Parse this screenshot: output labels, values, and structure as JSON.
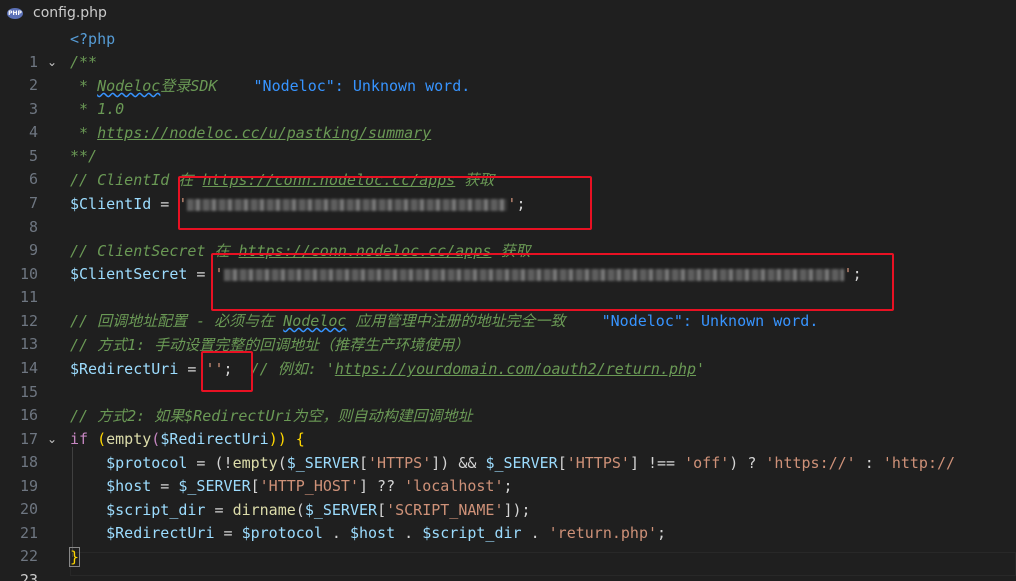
{
  "tab": {
    "badge": "PHP",
    "filename": "config.php"
  },
  "lines": [
    {
      "n": "1"
    },
    {
      "n": "2"
    },
    {
      "n": "3"
    },
    {
      "n": "4"
    },
    {
      "n": "5"
    },
    {
      "n": "6"
    },
    {
      "n": "7"
    },
    {
      "n": "8"
    },
    {
      "n": "9"
    },
    {
      "n": "10"
    },
    {
      "n": "11"
    },
    {
      "n": "12"
    },
    {
      "n": "13"
    },
    {
      "n": "14"
    },
    {
      "n": "15"
    },
    {
      "n": "16"
    },
    {
      "n": "17"
    },
    {
      "n": "18"
    },
    {
      "n": "19"
    },
    {
      "n": "20"
    },
    {
      "n": "21"
    },
    {
      "n": "22"
    },
    {
      "n": "23"
    }
  ],
  "code": {
    "l1": "<?php",
    "l2": "/**",
    "l3_star": " * ",
    "l3_word": "Nodeloc",
    "l3_rest": "登录SDK",
    "l3_diag": "\"Nodeloc\": Unknown word.",
    "l4": " * 1.0",
    "l5_star": " * ",
    "l5_url": "https://nodeloc.cc/u/pastking/summary",
    "l6": "**/",
    "l7_a": "// ClientId 在 ",
    "l7_url": "https://conn.nodeloc.cc/apps",
    "l7_b": " 获取",
    "l8_var": "$ClientId",
    "l8_eq": " = ",
    "l8_q1": "'",
    "l8_q2": "'",
    "l8_end": ";",
    "l10_a": "// ClientSecret 在 ",
    "l10_url": "https://conn.nodeloc.cc/apps",
    "l10_b": " 获取",
    "l11_var": "$ClientSecret",
    "l11_eq": " = ",
    "l11_q1": "'",
    "l11_q2": "'",
    "l11_end": ";",
    "l13_a": "// 回调地址配置 - 必须与在 ",
    "l13_word": "Nodeloc",
    "l13_b": " 应用管理中注册的地址完全一致",
    "l13_diag": "\"Nodeloc\": Unknown word.",
    "l14": "// 方式1: 手动设置完整的回调地址（推荐生产环境使用）",
    "l15_var": "$RedirectUri",
    "l15_eq": " = ",
    "l15_str": "''",
    "l15_semi": ";",
    "l15_c1": "  // 例如: '",
    "l15_url": "https://yourdomain.com/oauth2/return.php",
    "l15_c2": "'",
    "l17": "// 方式2: 如果$RedirectUri为空，则自动构建回调地址",
    "l18_if": "if",
    "l18_p1": " (",
    "l18_fn": "empty",
    "l18_p2": "(",
    "l18_var": "$RedirectUri",
    "l18_p3": "))",
    "l18_brace": " {",
    "l19_var": "    $protocol",
    "l19_eq": " = (!",
    "l19_fn": "empty",
    "l19_a": "(",
    "l19_srv": "$_SERVER",
    "l19_b": "[",
    "l19_s1": "'HTTPS'",
    "l19_c": "]) && ",
    "l19_srv2": "$_SERVER",
    "l19_d": "[",
    "l19_s2": "'HTTPS'",
    "l19_e": "] !== ",
    "l19_s3": "'off'",
    "l19_f": ") ? ",
    "l19_s4": "'https://'",
    "l19_g": " : ",
    "l19_s5": "'http://",
    "l20_var": "    $host",
    "l20_eq": " = ",
    "l20_srv": "$_SERVER",
    "l20_a": "[",
    "l20_s1": "'HTTP_HOST'",
    "l20_b": "] ?? ",
    "l20_s2": "'localhost'",
    "l20_c": ";",
    "l21_var": "    $script_dir",
    "l21_eq": " = ",
    "l21_fn": "dirname",
    "l21_a": "(",
    "l21_srv": "$_SERVER",
    "l21_b": "[",
    "l21_s1": "'SCRIPT_NAME'",
    "l21_c": "]);",
    "l22_var": "    $RedirectUri",
    "l22_eq": " = ",
    "l22_v1": "$protocol",
    "l22_a": " . ",
    "l22_v2": "$host",
    "l22_b": " . ",
    "l22_v3": "$script_dir",
    "l22_c": " . ",
    "l22_s1": "'return.php'",
    "l22_d": ";",
    "l23": "}"
  },
  "colors": {
    "background": "#1f1f1f",
    "comment": "#6a9955",
    "string": "#ce9178",
    "variable": "#9cdcfe",
    "keyword": "#c586c0",
    "function": "#dcdcaa",
    "annotation_box": "#e81123"
  }
}
